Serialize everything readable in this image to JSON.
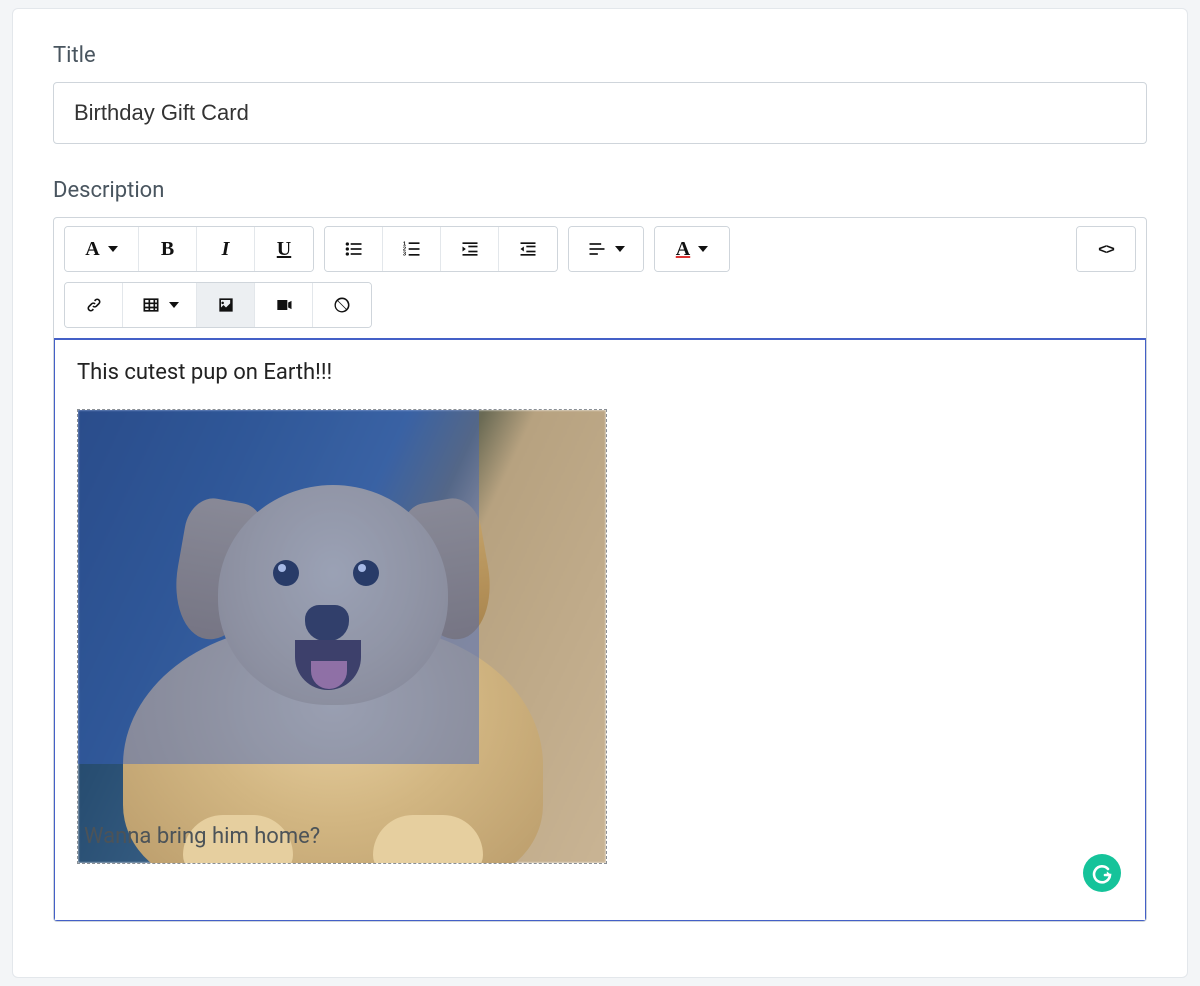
{
  "fields": {
    "title": {
      "label": "Title",
      "value": "Birthday Gift Card"
    },
    "description": {
      "label": "Description"
    }
  },
  "toolbar": {
    "font_style_glyph": "A",
    "bold_glyph": "B",
    "italic_glyph": "I",
    "underline_glyph": "U",
    "text_color_glyph": "A",
    "source_glyph": "<>"
  },
  "editor": {
    "line1": "This cutest pup on Earth!!!",
    "caption": "Wanna bring him home?",
    "image_alt": "golden retriever puppy",
    "selection_overlay": true
  },
  "badges": {
    "grammarly": "G"
  }
}
